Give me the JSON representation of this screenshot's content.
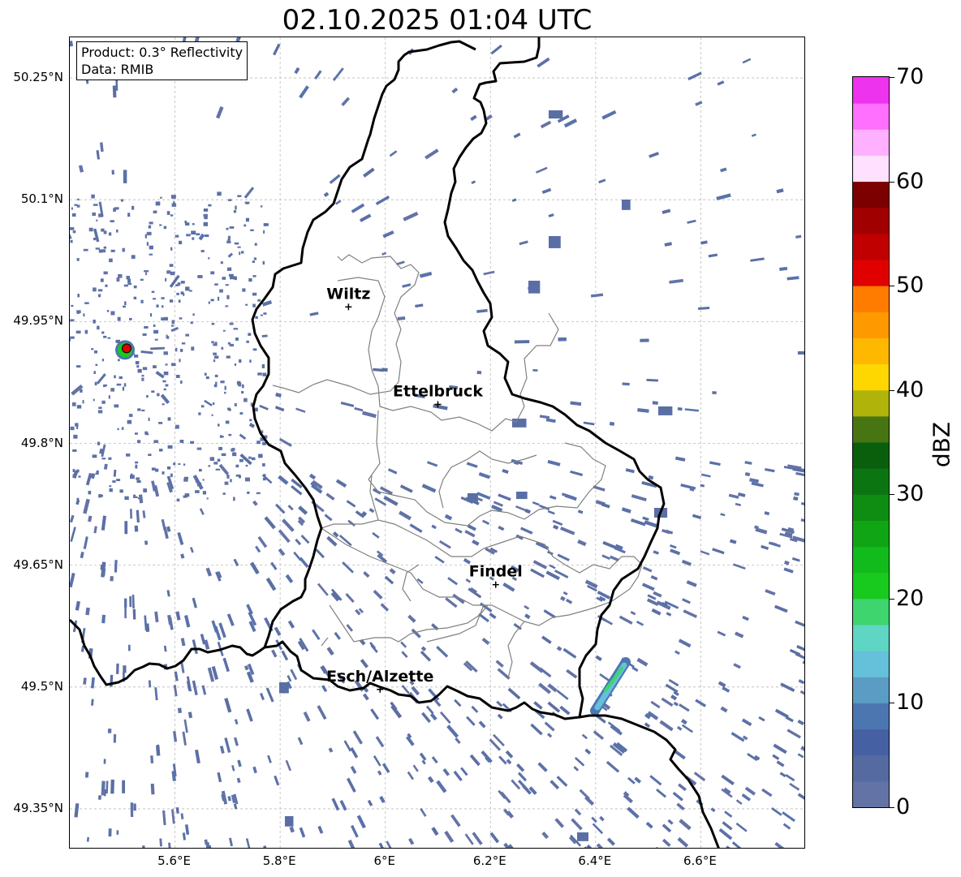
{
  "title": "02.10.2025 01:04 UTC",
  "info": {
    "product": "Product: 0.3° Reflectivity",
    "data": "Data: RMIB"
  },
  "map": {
    "lon_range": [
      5.4,
      6.8
    ],
    "lat_range": [
      49.3,
      50.3
    ],
    "lat_ticks": [
      {
        "value": 50.25,
        "label": "50.25°N"
      },
      {
        "value": 50.1,
        "label": "50.1°N"
      },
      {
        "value": 49.95,
        "label": "49.95°N"
      },
      {
        "value": 49.8,
        "label": "49.8°N"
      },
      {
        "value": 49.65,
        "label": "49.65°N"
      },
      {
        "value": 49.5,
        "label": "49.5°N"
      },
      {
        "value": 49.35,
        "label": "49.35°N"
      }
    ],
    "lon_ticks": [
      {
        "value": 5.6,
        "label": "5.6°E"
      },
      {
        "value": 5.8,
        "label": "5.8°E"
      },
      {
        "value": 6.0,
        "label": "6°E"
      },
      {
        "value": 6.2,
        "label": "6.2°E"
      },
      {
        "value": 6.4,
        "label": "6.4°E"
      },
      {
        "value": 6.6,
        "label": "6.6°E"
      }
    ],
    "cities": [
      {
        "name": "Wiltz",
        "lon": 5.93,
        "lat": 49.968
      },
      {
        "name": "Ettelbruck",
        "lon": 6.1,
        "lat": 49.848
      },
      {
        "name": "Findel",
        "lon": 6.21,
        "lat": 49.626
      },
      {
        "name": "Esch/Alzette",
        "lon": 5.99,
        "lat": 49.497
      }
    ],
    "radar_site": {
      "lon": 5.505,
      "lat": 49.915
    },
    "grid": true
  },
  "colorbar": {
    "label": "dBZ",
    "min": 0,
    "max": 70,
    "ticks": [
      "0",
      "10",
      "20",
      "30",
      "40",
      "50",
      "60",
      "70"
    ],
    "colors": [
      "#6473a6",
      "#546aa1",
      "#4661a3",
      "#4c76b0",
      "#5b9cc4",
      "#65c0d9",
      "#5fd6c4",
      "#3ed56f",
      "#18c91e",
      "#12bb1c",
      "#10a515",
      "#0e8d12",
      "#0b7511",
      "#0a5f0c",
      "#477512",
      "#b0b30a",
      "#ffd700",
      "#ffb800",
      "#ff9900",
      "#ff7c00",
      "#e10000",
      "#c00000",
      "#a00000",
      "#7c0000",
      "#ffe0ff",
      "#ffb0ff",
      "#ff70ff",
      "#ee33ee"
    ]
  }
}
